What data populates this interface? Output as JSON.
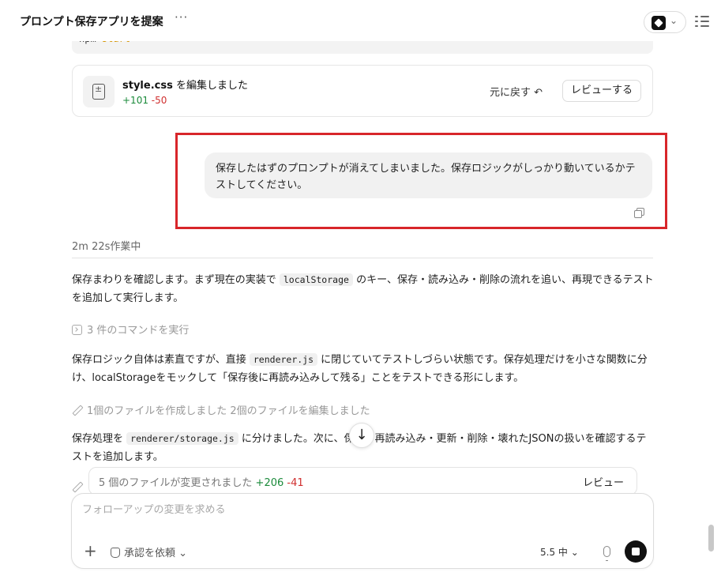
{
  "header": {
    "title": "プロンプト保存アプリを提案",
    "more": "···"
  },
  "code_block": {
    "prefix": "npm ",
    "command": "start"
  },
  "file_card": {
    "filename": "style.css",
    "action": " を編集しました",
    "additions": "+101",
    "deletions": "-50",
    "undo_label": "元に戻す ↶",
    "review_label": "レビューする"
  },
  "user_message": {
    "text": "保存したはずのプロンプトが消えてしまいました。保存ロジックがしっかり動いているかテストしてください。"
  },
  "working_status": "2m 22s作業中",
  "paragraph1": {
    "before": "保存まわりを確認します。まず現在の実装で ",
    "code": "localStorage",
    "after": " のキー、保存・読み込み・削除の流れを追い、再現できるテストを追加して実行します。"
  },
  "commands_line": "3 件のコマンドを実行",
  "paragraph2": {
    "before": "保存ロジック自体は素直ですが、直接 ",
    "code": "renderer.js",
    "after": " に閉じていてテストしづらい状態です。保存処理だけを小さな関数に分け、localStorageをモックして「保存後に再読み込みして残る」ことをテストできる形にします。"
  },
  "files_line": "1個のファイルを作成しました 2個のファイルを編集しました",
  "paragraph3": {
    "before": "保存処理を ",
    "code": "renderer/storage.js",
    "after": " に分けました。次に、保存・再読み込み・更新・削除・壊れたJSONの扱いを確認するテストを追加します。"
  },
  "changes_bar": {
    "text": "5 個のファイルが変更されました ",
    "additions": "+206",
    "deletions": "-41",
    "review_label": "レビュー"
  },
  "composer": {
    "placeholder": "フォローアップの変更を求める",
    "plus": "+",
    "approval_label": "承認を依頼 ⌄",
    "model_label": "5.5  中 ⌄"
  },
  "colors": {
    "highlight_border": "#d8262a",
    "additions": "#1a8a3a",
    "deletions": "#d03030"
  }
}
